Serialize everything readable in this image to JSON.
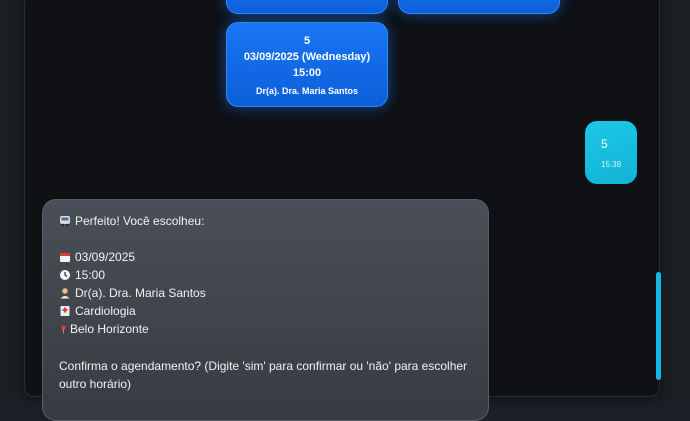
{
  "options": [
    {
      "number": "",
      "date": "",
      "time": "",
      "doctor": ""
    },
    {
      "number": "",
      "date": "",
      "time": "",
      "doctor": ""
    },
    {
      "number": "5",
      "date": "03/09/2025 (Wednesday)",
      "time": "15:00",
      "doctor": "Dr(a). Dra. Maria Santos"
    }
  ],
  "user_message": {
    "text": "5",
    "time": "15:39"
  },
  "bot_message": {
    "header": "Perfeito! Você escolheu:",
    "date": "03/09/2025",
    "time": "15:00",
    "doctor": "Dr(a). Dra. Maria Santos",
    "specialty": "Cardiologia",
    "location": "Belo Horizonte",
    "confirm_line1": "Confirma o agendamento? (Digite 'sim' para confirmar ou 'não' para escolher",
    "confirm_line2": "outro horário)"
  },
  "icons": {
    "header": "bus-icon",
    "date": "calendar-icon",
    "time": "clock-icon",
    "doctor": "doctor-icon",
    "specialty": "clinic-icon",
    "location": "pin-icon"
  },
  "colors": {
    "accent_blue": "#1876f5",
    "user_bubble": "#1cc8e8",
    "bot_bubble": "#42464e"
  }
}
